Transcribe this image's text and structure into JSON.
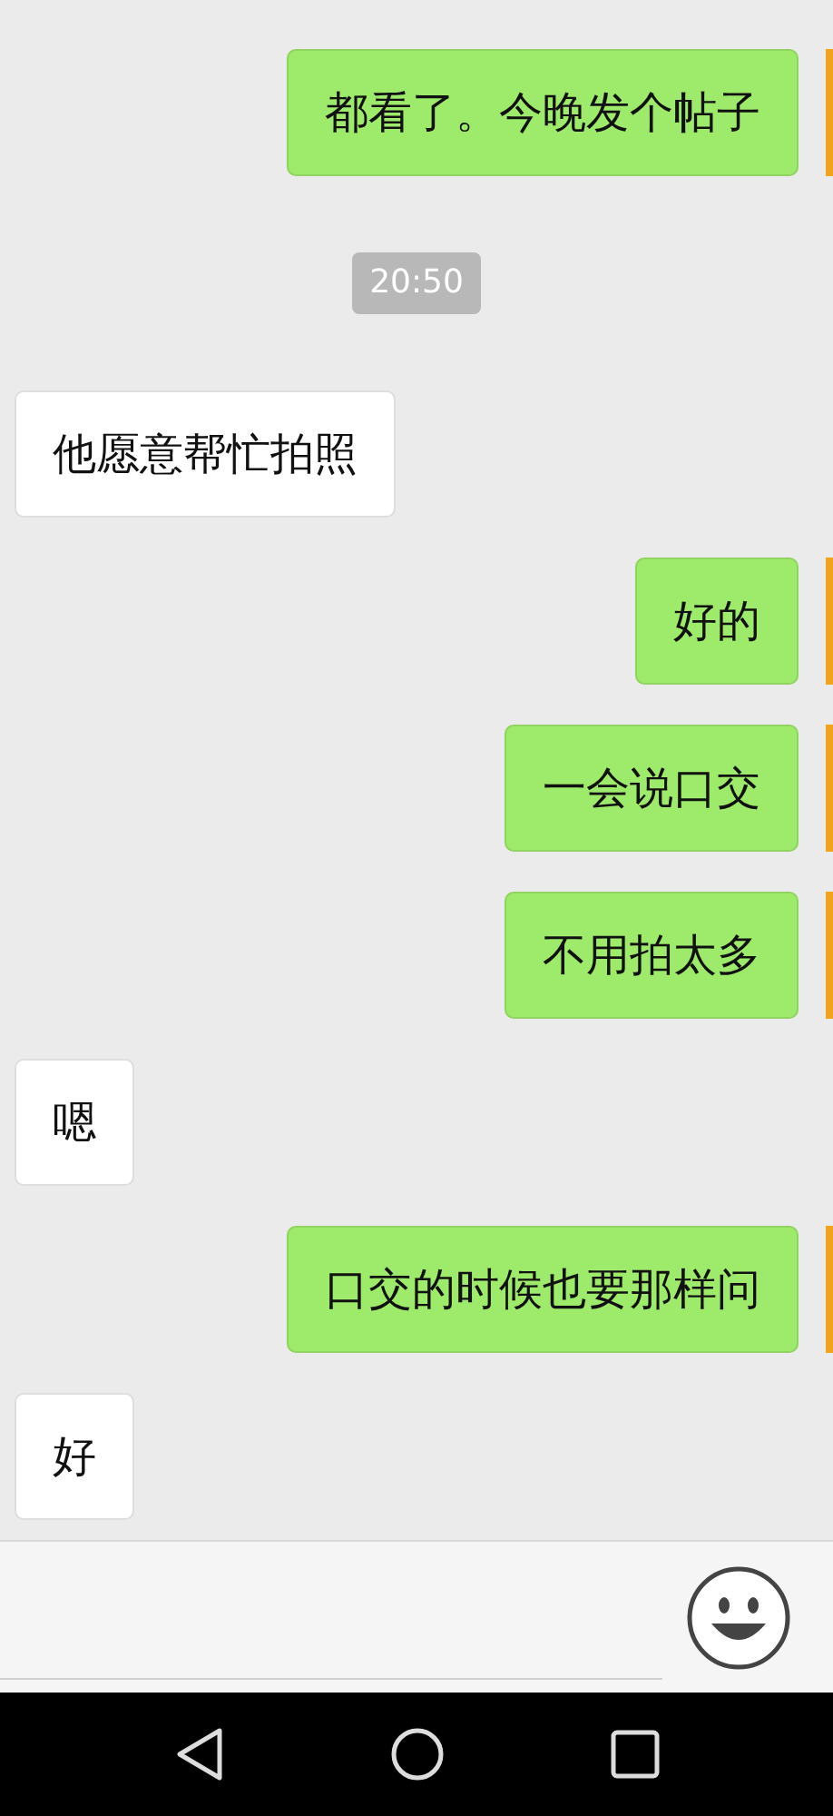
{
  "messages": [
    {
      "kind": "sent",
      "text": "都看了。今晚发个帖子"
    },
    {
      "kind": "time",
      "text": "20:50"
    },
    {
      "kind": "received",
      "text": "他愿意帮忙拍照"
    },
    {
      "kind": "sent",
      "text": "好的"
    },
    {
      "kind": "sent",
      "text": "一会说口交"
    },
    {
      "kind": "sent",
      "text": "不用拍太多"
    },
    {
      "kind": "received",
      "text": "嗯"
    },
    {
      "kind": "sent",
      "text": "口交的时候也要那样问"
    },
    {
      "kind": "received",
      "text": "好"
    }
  ]
}
